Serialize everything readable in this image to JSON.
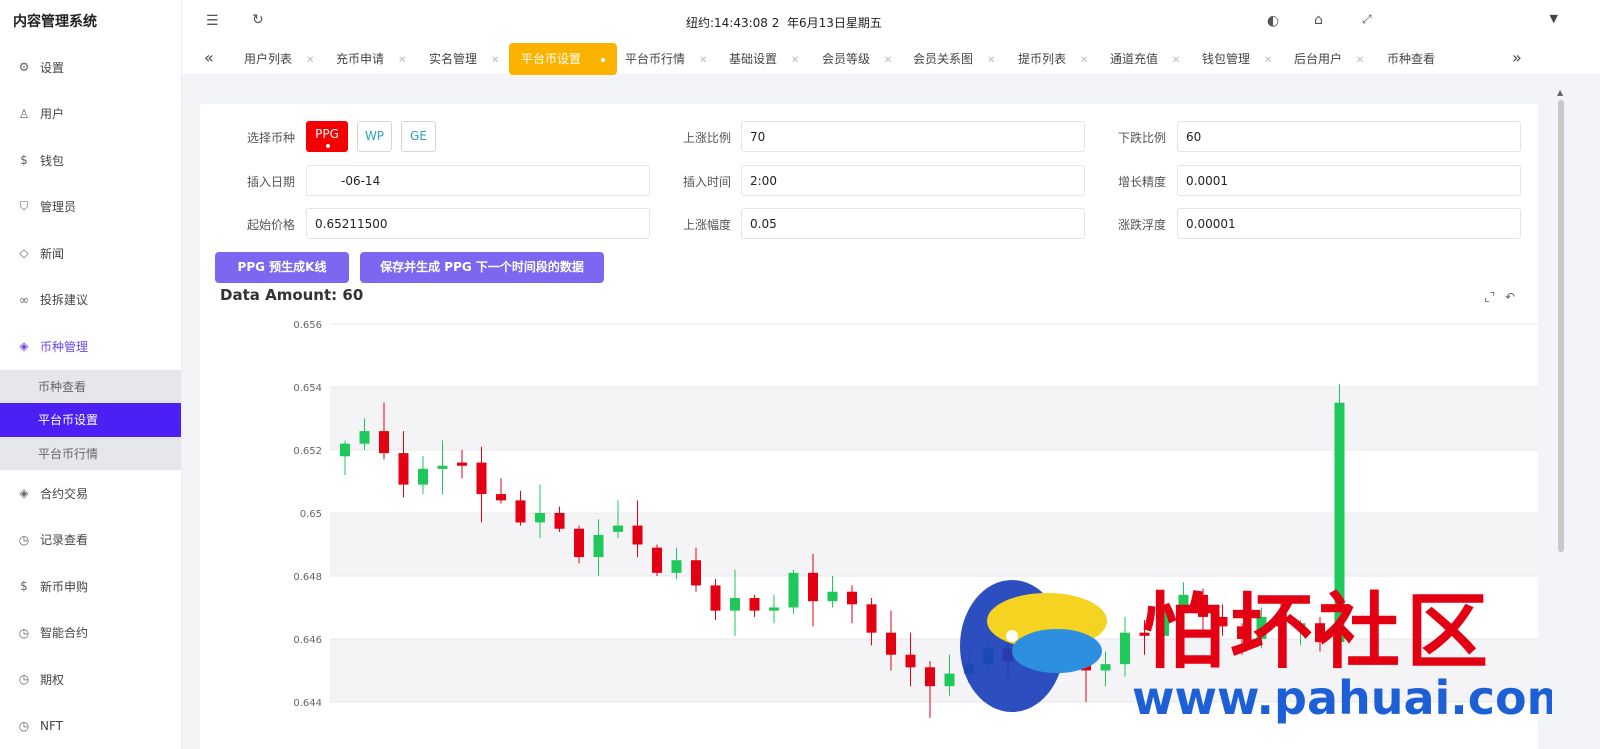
{
  "app": {
    "title": "内容管理系统"
  },
  "topbar": {
    "clock": "纽约:14:43:08 2",
    "date": "年6月13日星期五"
  },
  "sidebar": {
    "items": [
      {
        "label": "设置",
        "icon": "gear-icon"
      },
      {
        "label": "用户",
        "icon": "user-icon"
      },
      {
        "label": "钱包",
        "icon": "dollar-icon"
      },
      {
        "label": "管理员",
        "icon": "shield-icon"
      },
      {
        "label": "新闻",
        "icon": "tag-icon"
      },
      {
        "label": "投拆建议",
        "icon": "link-icon"
      },
      {
        "label": "币种管理",
        "icon": "diamond-icon"
      }
    ],
    "submenu": [
      "币种查看",
      "平台币设置",
      "平台币行情"
    ],
    "items2": [
      {
        "label": "合约交易",
        "icon": "diamond-icon"
      },
      {
        "label": "记录查看",
        "icon": "clock-icon"
      },
      {
        "label": "新币申购",
        "icon": "dollar-icon"
      },
      {
        "label": "智能合约",
        "icon": "clock-icon"
      },
      {
        "label": "期权",
        "icon": "clock-icon"
      },
      {
        "label": "NFT",
        "icon": "clock-icon"
      }
    ]
  },
  "tabs": [
    "用户列表",
    "充币申请",
    "实名管理",
    "平台币设置",
    "平台币行情",
    "基础设置",
    "会员等级",
    "会员关系图",
    "提币列表",
    "通道充值",
    "钱包管理",
    "后台用户",
    "币种查看"
  ],
  "form": {
    "coin_label": "选择币种",
    "coins": [
      "PPG",
      "WP",
      "GE"
    ],
    "up_ratio_label": "上涨比例",
    "up_ratio": "70",
    "down_ratio_label": "下跌比例",
    "down_ratio": "60",
    "insert_date_label": "插入日期",
    "insert_date": "-06-14",
    "insert_time_label": "插入时间",
    "insert_time": "2:00",
    "precision_label": "增长精度",
    "precision": "0.0001",
    "start_price_label": "起始价格",
    "start_price": "0.65211500",
    "rise_label": "上涨幅度",
    "rise": "0.05",
    "float_label": "涨跌浮度",
    "float": "0.00001"
  },
  "actions": {
    "pregen": "PPG 预生成K线",
    "save": "保存并生成 PPG 下一个时间段的数据"
  },
  "amount_text": "Data Amount: 60",
  "watermark": {
    "text": "怕坏社区",
    "url": "www.pahuai.com"
  },
  "colors": {
    "up": "#1fc85a",
    "down": "#e30012",
    "accent": "#6b46e8",
    "active_tab": "#fbb300"
  },
  "chart_data": {
    "type": "candlestick",
    "y_ticks": [
      "0.656",
      "0.654",
      "0.652",
      "0.65",
      "0.648",
      "0.646",
      "0.644"
    ],
    "ylim": [
      0.6433,
      0.656
    ],
    "candles": [
      {
        "o": 0.6518,
        "c": 0.6522,
        "h": 0.6523,
        "l": 0.6512
      },
      {
        "o": 0.6522,
        "c": 0.6526,
        "h": 0.653,
        "l": 0.652
      },
      {
        "o": 0.6526,
        "c": 0.6519,
        "h": 0.6535,
        "l": 0.6517
      },
      {
        "o": 0.6519,
        "c": 0.6509,
        "h": 0.6526,
        "l": 0.6505
      },
      {
        "o": 0.6509,
        "c": 0.6514,
        "h": 0.6518,
        "l": 0.6506
      },
      {
        "o": 0.6514,
        "c": 0.6515,
        "h": 0.6523,
        "l": 0.6506
      },
      {
        "o": 0.6516,
        "c": 0.6515,
        "h": 0.652,
        "l": 0.6511
      },
      {
        "o": 0.6516,
        "c": 0.6506,
        "h": 0.6521,
        "l": 0.6497
      },
      {
        "o": 0.6506,
        "c": 0.6504,
        "h": 0.6511,
        "l": 0.6503
      },
      {
        "o": 0.6504,
        "c": 0.6497,
        "h": 0.6507,
        "l": 0.6496
      },
      {
        "o": 0.6497,
        "c": 0.65,
        "h": 0.6509,
        "l": 0.6492
      },
      {
        "o": 0.65,
        "c": 0.6495,
        "h": 0.6502,
        "l": 0.6494
      },
      {
        "o": 0.6495,
        "c": 0.6486,
        "h": 0.6496,
        "l": 0.6484
      },
      {
        "o": 0.6486,
        "c": 0.6493,
        "h": 0.6498,
        "l": 0.648
      },
      {
        "o": 0.6494,
        "c": 0.6496,
        "h": 0.6504,
        "l": 0.6492
      },
      {
        "o": 0.6496,
        "c": 0.649,
        "h": 0.6504,
        "l": 0.6486
      },
      {
        "o": 0.6489,
        "c": 0.6481,
        "h": 0.649,
        "l": 0.648
      },
      {
        "o": 0.6481,
        "c": 0.6485,
        "h": 0.6489,
        "l": 0.6479
      },
      {
        "o": 0.6485,
        "c": 0.6477,
        "h": 0.6489,
        "l": 0.6475
      },
      {
        "o": 0.6477,
        "c": 0.6469,
        "h": 0.6479,
        "l": 0.6466
      },
      {
        "o": 0.6469,
        "c": 0.6473,
        "h": 0.6482,
        "l": 0.6461
      },
      {
        "o": 0.6473,
        "c": 0.6469,
        "h": 0.6474,
        "l": 0.6467
      },
      {
        "o": 0.6469,
        "c": 0.647,
        "h": 0.6474,
        "l": 0.6465
      },
      {
        "o": 0.647,
        "c": 0.6481,
        "h": 0.6482,
        "l": 0.6468
      },
      {
        "o": 0.6481,
        "c": 0.6472,
        "h": 0.6487,
        "l": 0.6464
      },
      {
        "o": 0.6472,
        "c": 0.6475,
        "h": 0.648,
        "l": 0.647
      },
      {
        "o": 0.6475,
        "c": 0.6471,
        "h": 0.6477,
        "l": 0.6465
      },
      {
        "o": 0.6471,
        "c": 0.6462,
        "h": 0.6473,
        "l": 0.6458
      },
      {
        "o": 0.6462,
        "c": 0.6455,
        "h": 0.6469,
        "l": 0.645
      },
      {
        "o": 0.6455,
        "c": 0.6451,
        "h": 0.6462,
        "l": 0.6445
      },
      {
        "o": 0.6451,
        "c": 0.6445,
        "h": 0.6453,
        "l": 0.6435
      },
      {
        "o": 0.6445,
        "c": 0.6449,
        "h": 0.6455,
        "l": 0.6442
      },
      {
        "o": 0.6449,
        "c": 0.6452,
        "h": 0.6456,
        "l": 0.6446
      },
      {
        "o": 0.6452,
        "c": 0.6457,
        "h": 0.6459,
        "l": 0.645
      },
      {
        "o": 0.6457,
        "c": 0.6453,
        "h": 0.6462,
        "l": 0.6448
      },
      {
        "o": 0.6453,
        "c": 0.6459,
        "h": 0.6461,
        "l": 0.6451
      },
      {
        "o": 0.6459,
        "c": 0.646,
        "h": 0.6463,
        "l": 0.6455
      },
      {
        "o": 0.6461,
        "c": 0.6454,
        "h": 0.6465,
        "l": 0.6451
      },
      {
        "o": 0.6454,
        "c": 0.645,
        "h": 0.6458,
        "l": 0.644
      },
      {
        "o": 0.645,
        "c": 0.6452,
        "h": 0.6456,
        "l": 0.6445
      },
      {
        "o": 0.6452,
        "c": 0.6462,
        "h": 0.6467,
        "l": 0.6448
      },
      {
        "o": 0.6462,
        "c": 0.6461,
        "h": 0.6466,
        "l": 0.6455
      },
      {
        "o": 0.6461,
        "c": 0.6469,
        "h": 0.647,
        "l": 0.6456
      },
      {
        "o": 0.6469,
        "c": 0.6474,
        "h": 0.6478,
        "l": 0.6465
      },
      {
        "o": 0.6474,
        "c": 0.6467,
        "h": 0.6476,
        "l": 0.6463
      },
      {
        "o": 0.6467,
        "c": 0.6464,
        "h": 0.6471,
        "l": 0.6461
      },
      {
        "o": 0.6464,
        "c": 0.646,
        "h": 0.6465,
        "l": 0.6455
      },
      {
        "o": 0.646,
        "c": 0.6467,
        "h": 0.647,
        "l": 0.6457
      },
      {
        "o": 0.6467,
        "c": 0.6464,
        "h": 0.6472,
        "l": 0.6459
      },
      {
        "o": 0.6464,
        "c": 0.6465,
        "h": 0.6466,
        "l": 0.6458
      },
      {
        "o": 0.6465,
        "c": 0.6459,
        "h": 0.6467,
        "l": 0.6456
      },
      {
        "o": 0.6459,
        "c": 0.6535,
        "h": 0.6541,
        "l": 0.6458
      }
    ]
  }
}
